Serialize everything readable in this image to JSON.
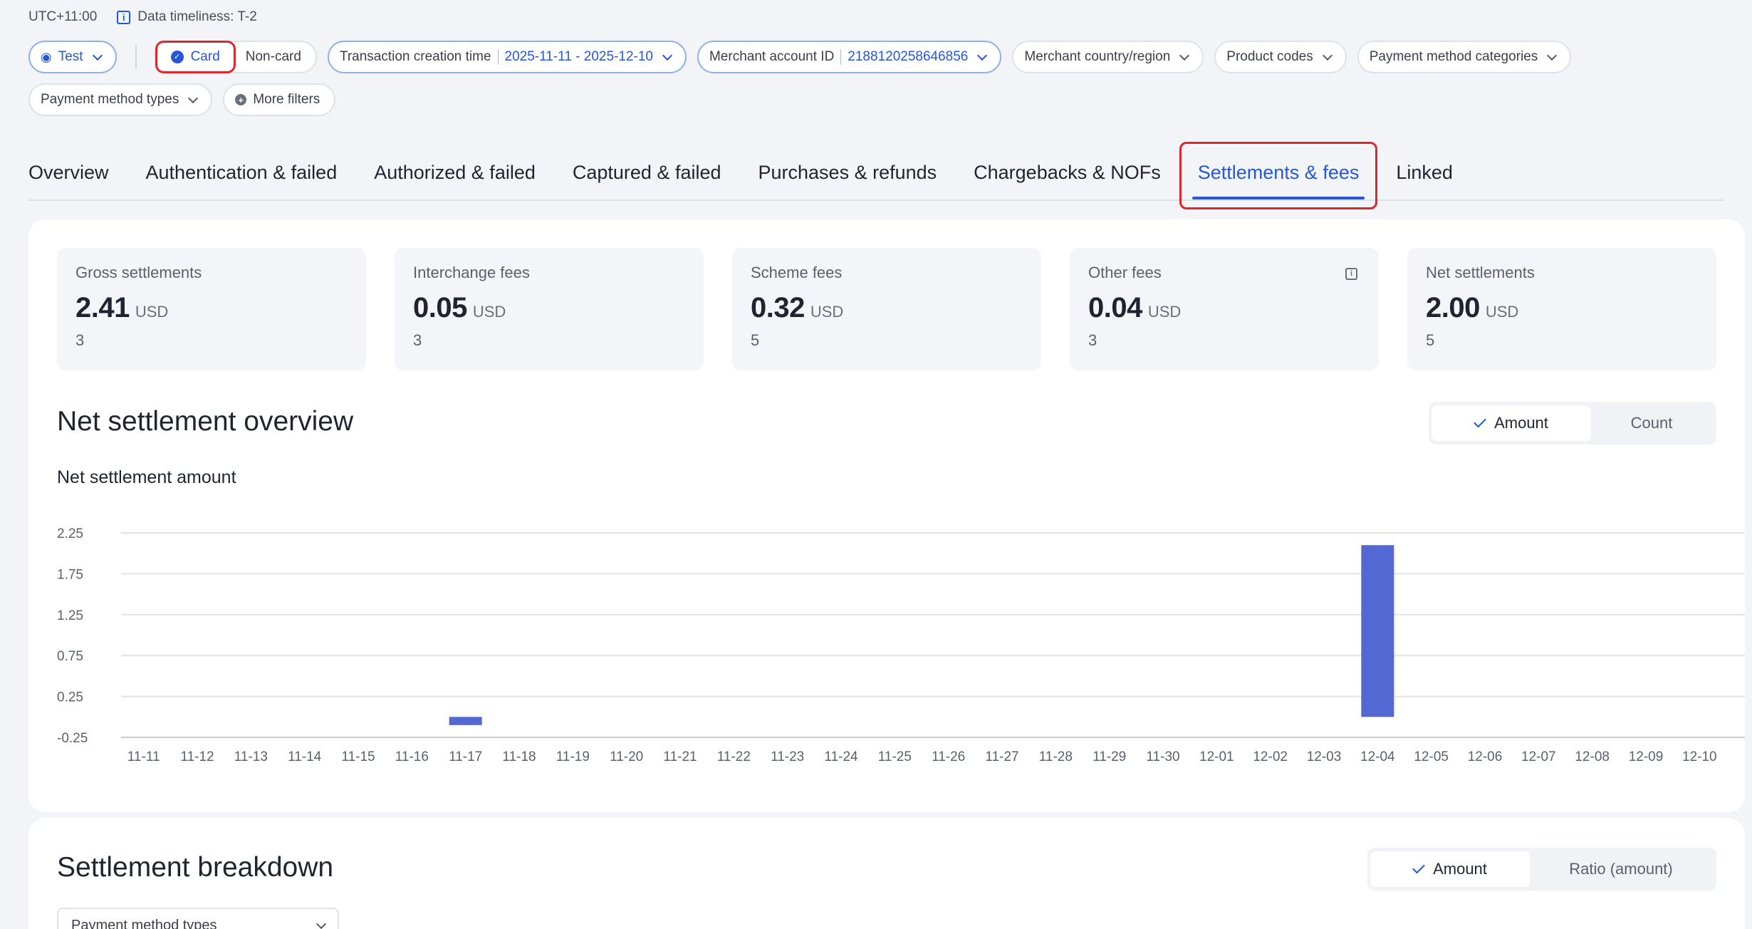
{
  "topbar": {
    "timezone": "UTC+11:00",
    "timeliness": "Data timeliness: T-2"
  },
  "filters": {
    "env": "Test",
    "card": "Card",
    "noncard": "Non-card",
    "time_label": "Transaction creation time",
    "time_value": "2025-11-11 - 2025-12-10",
    "merchant_label": "Merchant account ID",
    "merchant_value": "2188120258646856",
    "country": "Merchant country/region",
    "product": "Product codes",
    "pm_categories": "Payment method categories",
    "pm_types": "Payment method types",
    "more": "More filters"
  },
  "tabs": [
    "Overview",
    "Authentication & failed",
    "Authorized & failed",
    "Captured & failed",
    "Purchases & refunds",
    "Chargebacks & NOFs",
    "Settlements & fees",
    "Linked"
  ],
  "active_tab": "Settlements & fees",
  "kpis": [
    {
      "title": "Gross settlements",
      "value": "2.41",
      "unit": "USD",
      "count": "3"
    },
    {
      "title": "Interchange fees",
      "value": "0.05",
      "unit": "USD",
      "count": "3"
    },
    {
      "title": "Scheme fees",
      "value": "0.32",
      "unit": "USD",
      "count": "5"
    },
    {
      "title": "Other fees",
      "value": "0.04",
      "unit": "USD",
      "count": "3"
    },
    {
      "title": "Net settlements",
      "value": "2.00",
      "unit": "USD",
      "count": "5"
    }
  ],
  "overview": {
    "title": "Net settlement overview",
    "toggle_amount": "Amount",
    "toggle_count": "Count",
    "chart_title": "Net settlement amount"
  },
  "breakdown": {
    "title": "Settlement breakdown",
    "toggle_amount": "Amount",
    "toggle_ratio": "Ratio (amount)",
    "select": "Payment method types"
  },
  "chart_data": {
    "type": "bar",
    "title": "Net settlement amount",
    "xlabel": "",
    "ylabel": "",
    "ylim": [
      -0.25,
      2.25
    ],
    "yticks": [
      2.25,
      1.75,
      1.25,
      0.75,
      0.25,
      -0.25
    ],
    "grid": true,
    "color": "#5468d4",
    "categories": [
      "11-11",
      "11-12",
      "11-13",
      "11-14",
      "11-15",
      "11-16",
      "11-17",
      "11-18",
      "11-19",
      "11-20",
      "11-21",
      "11-22",
      "11-23",
      "11-24",
      "11-25",
      "11-26",
      "11-27",
      "11-28",
      "11-29",
      "11-30",
      "12-01",
      "12-02",
      "12-03",
      "12-04",
      "12-05",
      "12-06",
      "12-07",
      "12-08",
      "12-09",
      "12-10"
    ],
    "values": [
      0,
      0,
      0,
      0,
      0,
      0,
      -0.1,
      0,
      0,
      0,
      0,
      0,
      0,
      0,
      0,
      0,
      0,
      0,
      0,
      0,
      0,
      0,
      0,
      2.1,
      0,
      0,
      0,
      0,
      0,
      0
    ]
  }
}
